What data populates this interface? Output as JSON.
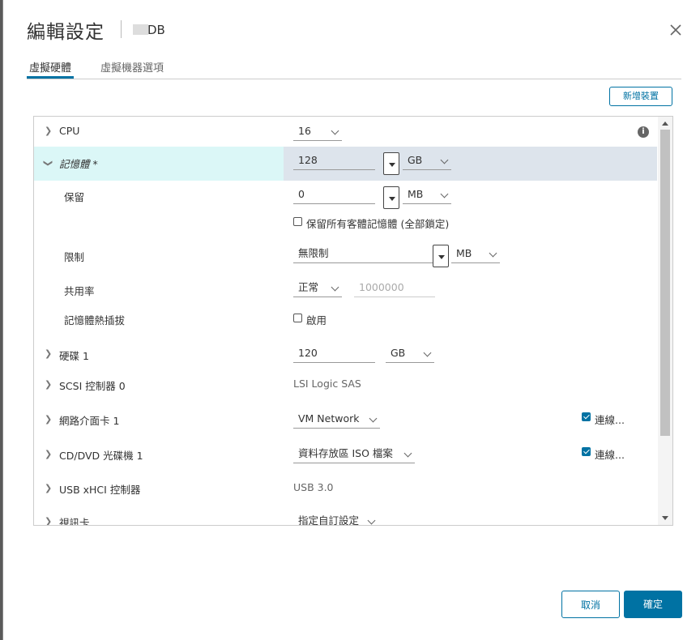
{
  "dialog": {
    "title": "編輯設定",
    "vm_name": "DB",
    "tabs": [
      "虛擬硬體",
      "虛擬機器選項"
    ],
    "add_device": "新增裝置",
    "cancel": "取消",
    "ok": "確定"
  },
  "hardware": {
    "cpu": {
      "label": "CPU",
      "value": "16"
    },
    "memory": {
      "label": "記憶體 *",
      "size": "128",
      "unit": "GB",
      "reservation": {
        "label": "保留",
        "value": "0",
        "unit": "MB",
        "lock_label": "保留所有客體記憶體 (全部鎖定)",
        "lock_checked": false
      },
      "limit": {
        "label": "限制",
        "value": "無限制",
        "unit": "MB"
      },
      "shares": {
        "label": "共用率",
        "level": "正常",
        "value": "1000000"
      },
      "hotplug": {
        "label": "記憶體熱插拔",
        "enable_label": "啟用",
        "checked": false
      }
    },
    "disk": {
      "label": "硬碟 1",
      "size": "120",
      "unit": "GB"
    },
    "scsi": {
      "label": "SCSI 控制器 0",
      "value": "LSI Logic SAS"
    },
    "nic": {
      "label": "網路介面卡 1",
      "network": "VM Network",
      "connect_label": "連線...",
      "connected": true
    },
    "cd": {
      "label": "CD/DVD 光碟機 1",
      "source": "資料存放區 ISO 檔案",
      "connect_label": "連線...",
      "connected": true
    },
    "usb": {
      "label": "USB xHCI 控制器",
      "value": "USB 3.0"
    },
    "video": {
      "label": "視訊卡",
      "value": "指定自訂設定"
    }
  },
  "colors": {
    "accent": "#0072a3",
    "row_highlight": "#dbf7f7",
    "value_highlight": "#dde4ec"
  }
}
